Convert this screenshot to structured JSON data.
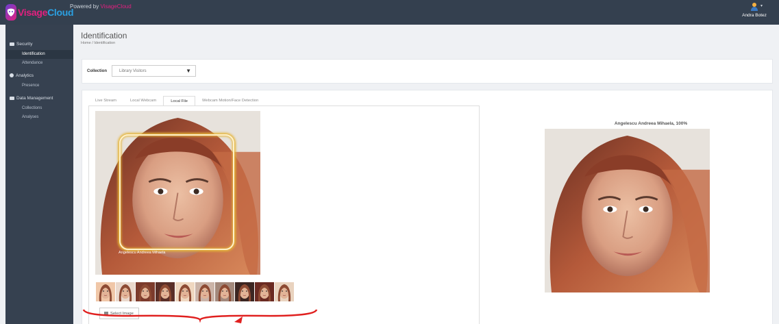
{
  "header": {
    "logo_text_a": "Visage",
    "logo_text_b": "Cloud",
    "powered_prefix": "Powered by ",
    "powered_brand": "VisageCloud",
    "user_name": "Andra Botez",
    "user_caret": "▾"
  },
  "sidebar": {
    "sections": [
      {
        "label": "Security",
        "icon": "video-camera-icon",
        "items": [
          "Identification",
          "Attendance"
        ]
      },
      {
        "label": "Analytics",
        "icon": "pie-chart-icon",
        "items": [
          "Presence"
        ]
      },
      {
        "label": "Data Management",
        "icon": "database-icon",
        "items": [
          "Collections",
          "Analyses"
        ]
      }
    ],
    "active_item": "Identification"
  },
  "page": {
    "title": "Identification",
    "breadcrumb": "Home  /  Identification"
  },
  "collection": {
    "label": "Collection",
    "selected": "Library Visitors",
    "arrow": "▼"
  },
  "tabs": [
    "Live Stream",
    "Local Webcam",
    "Local File",
    "Webcam Motion/Face Detection"
  ],
  "active_tab": "Local File",
  "detection": {
    "face_label": "Angelescu Andreea Mihaela"
  },
  "thumbnails_count": 10,
  "select_button": "Select Image",
  "result": {
    "title": "Angelescu Andreea Mihaela, 100%"
  },
  "colors": {
    "topbar": "#34404f",
    "sidebar": "#364150",
    "accent_pink": "#e2207f",
    "accent_blue": "#2b9fe0",
    "face_box_glow": "#e5b437",
    "annotation_red": "#e0201f"
  }
}
